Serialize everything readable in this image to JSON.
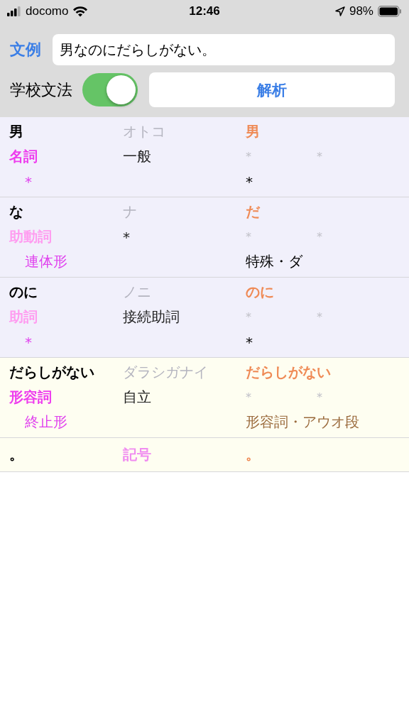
{
  "status_bar": {
    "carrier": "docomo",
    "time": "12:46",
    "battery": "98%"
  },
  "header": {
    "example_link": "文例",
    "sentence": {
      "value": "男なのにだらしがない。"
    },
    "toggle": {
      "label": "学校文法",
      "on": true
    },
    "analyze_button": "解析"
  },
  "tokens": [
    {
      "kind": "word",
      "color": "#f1f0fb",
      "surface": "男",
      "reading": "オトコ",
      "base": "男",
      "pos": {
        "text": "名詞",
        "color": "#ee3cee"
      },
      "pos_detail": "一般",
      "pos_detail_2": "*",
      "pos_detail_3": "*",
      "conj_form": "*",
      "conj_type": {
        "text": "*",
        "color": "#000000"
      }
    },
    {
      "kind": "word",
      "color": "#f1f0fb",
      "surface": "な",
      "reading": "ナ",
      "base": "だ",
      "pos": {
        "text": "助動詞",
        "color": "#ff9cf0"
      },
      "pos_detail": "*",
      "pos_detail_2": "*",
      "pos_detail_3": "*",
      "conj_form": "連体形",
      "conj_type": {
        "text": "特殊・ダ",
        "color": "#000000"
      }
    },
    {
      "kind": "word",
      "color": "#f1f0fb",
      "surface": "のに",
      "reading": "ノニ",
      "base": "のに",
      "pos": {
        "text": "助詞",
        "color": "#ff9cf0"
      },
      "pos_detail": "接続助詞",
      "pos_detail_2": "*",
      "pos_detail_3": "*",
      "conj_form": "*",
      "conj_type": {
        "text": "*",
        "color": "#000000"
      }
    },
    {
      "kind": "word",
      "color": "#fefef1",
      "surface": "だらしがない",
      "reading": "ダラシガナイ",
      "base": "だらしがない",
      "pos": {
        "text": "形容詞",
        "color": "#ee3cee"
      },
      "pos_detail": "自立",
      "pos_detail_2": "*",
      "pos_detail_3": "*",
      "conj_form": "終止形",
      "conj_type": {
        "text": "形容詞・アウオ段",
        "color": "#9a6a3c"
      }
    },
    {
      "kind": "symbol",
      "color": "#fefef1",
      "surface": "。",
      "pos": {
        "text": "記号",
        "color": "#f08cf0"
      },
      "base": "。"
    }
  ]
}
